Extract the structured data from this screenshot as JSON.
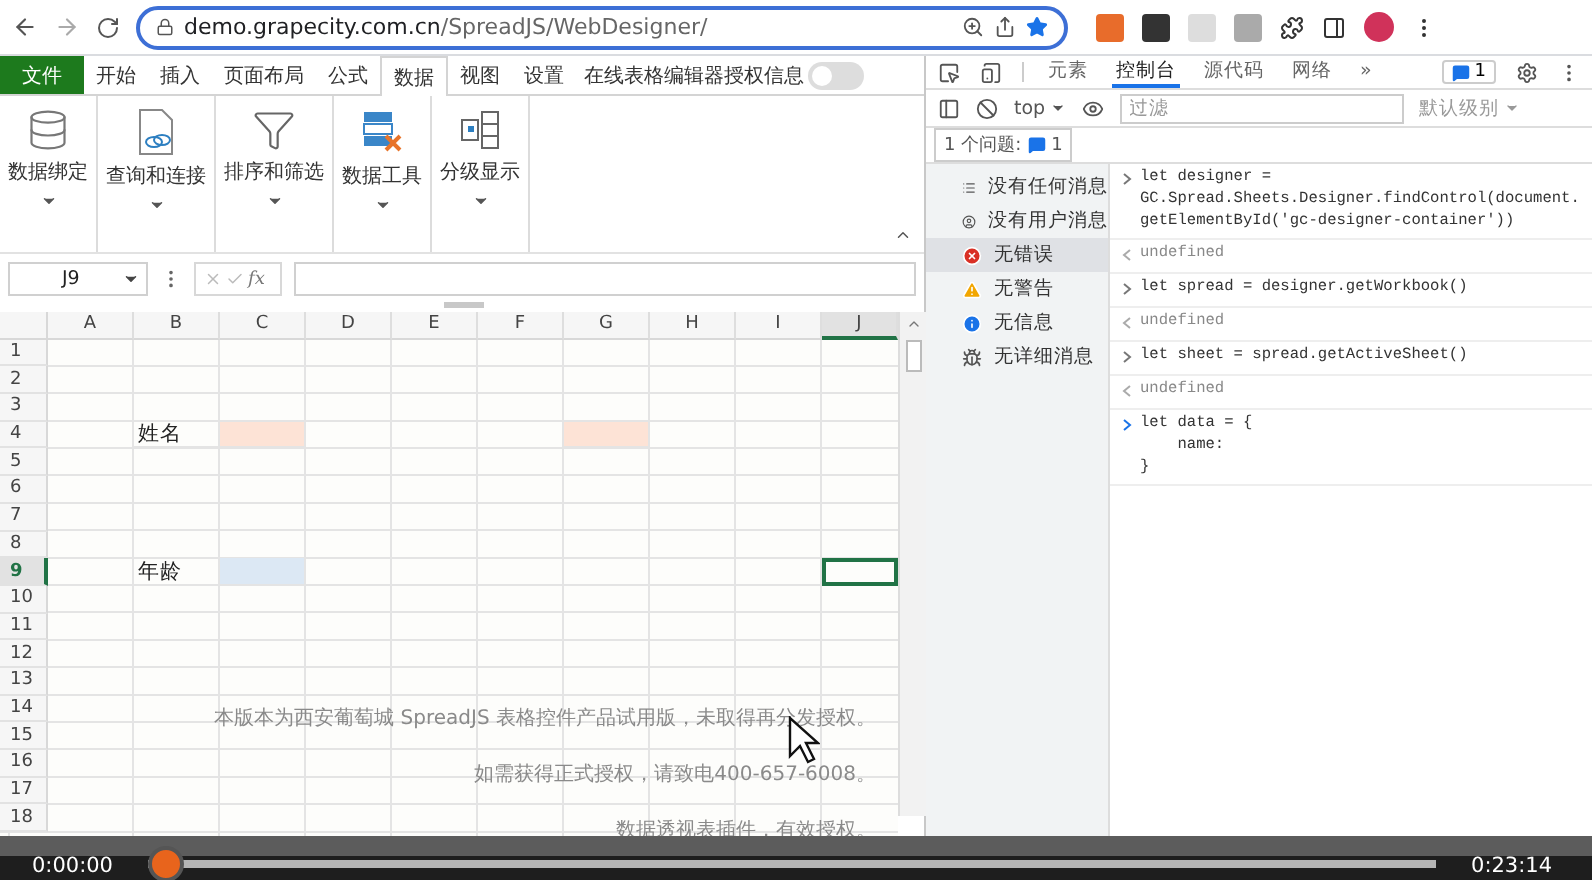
{
  "browser": {
    "url_host": "demo.grapecity.com.cn",
    "url_path": "/SpreadJS/WebDesigner/"
  },
  "ribbon": {
    "tabs": [
      {
        "label": "文件",
        "kind": "file",
        "selected": false
      },
      {
        "label": "开始",
        "kind": "tab",
        "selected": false
      },
      {
        "label": "插入",
        "kind": "tab",
        "selected": false
      },
      {
        "label": "页面布局",
        "kind": "tab",
        "selected": false
      },
      {
        "label": "公式",
        "kind": "tab",
        "selected": false
      },
      {
        "label": "数据",
        "kind": "tab",
        "selected": true
      },
      {
        "label": "视图",
        "kind": "tab",
        "selected": false
      },
      {
        "label": "设置",
        "kind": "tab",
        "selected": false
      }
    ],
    "license_label": "在线表格编辑器授权信息",
    "license_switch": {
      "on": false
    },
    "groups": [
      {
        "label": "数据绑定",
        "kind": "binding"
      },
      {
        "label": "查询和连接",
        "kind": "query"
      },
      {
        "label": "排序和筛选",
        "kind": "sort"
      },
      {
        "label": "数据工具",
        "kind": "tools"
      },
      {
        "label": "分级显示",
        "kind": "outline"
      }
    ]
  },
  "formula_bar": {
    "name_box": "J9",
    "fx": "fx"
  },
  "sheet": {
    "columns": [
      {
        "label": "A",
        "selected": false
      },
      {
        "label": "B",
        "selected": false
      },
      {
        "label": "C",
        "selected": false
      },
      {
        "label": "D",
        "selected": false
      },
      {
        "label": "E",
        "selected": false
      },
      {
        "label": "F",
        "selected": false
      },
      {
        "label": "G",
        "selected": false
      },
      {
        "label": "H",
        "selected": false
      },
      {
        "label": "I",
        "selected": false
      },
      {
        "label": "J",
        "selected": true
      }
    ],
    "rows": [
      {
        "label": "1",
        "selected": false
      },
      {
        "label": "2",
        "selected": false
      },
      {
        "label": "3",
        "selected": false
      },
      {
        "label": "4",
        "selected": false,
        "cells": [
          {
            "kind": "empty"
          },
          {
            "kind": "text",
            "text": "姓名"
          },
          {
            "kind": "fill",
            "color": "#fde3d6"
          },
          {
            "kind": "empty"
          },
          {
            "kind": "empty"
          },
          {
            "kind": "empty"
          },
          {
            "kind": "fill",
            "color": "#fde3d6"
          }
        ]
      },
      {
        "label": "5",
        "selected": false
      },
      {
        "label": "6",
        "selected": false
      },
      {
        "label": "7",
        "selected": false
      },
      {
        "label": "8",
        "selected": false
      },
      {
        "label": "9",
        "selected": true,
        "cells": [
          {
            "kind": "empty"
          },
          {
            "kind": "text",
            "text": "年龄"
          },
          {
            "kind": "fill",
            "color": "#dce8f4"
          }
        ]
      },
      {
        "label": "10",
        "selected": false
      },
      {
        "label": "11",
        "selected": false
      },
      {
        "label": "12",
        "selected": false
      },
      {
        "label": "13",
        "selected": false
      },
      {
        "label": "14",
        "selected": false
      },
      {
        "label": "15",
        "selected": false
      },
      {
        "label": "16",
        "selected": false
      },
      {
        "label": "17",
        "selected": false
      },
      {
        "label": "18",
        "selected": false
      }
    ],
    "watermark_lines": [
      "本版本为西安葡萄城 SpreadJS 表格控件产品试用版，未取得再分发授权。",
      "如需获得正式授权，请致电400-657-6008。",
      "数据透视表插件，有效授权。"
    ]
  },
  "devtools": {
    "tabs": [
      {
        "label": "元素",
        "selected": false
      },
      {
        "label": "控制台",
        "selected": true
      },
      {
        "label": "源代码",
        "selected": false
      },
      {
        "label": "网络",
        "selected": false
      }
    ],
    "more_tabs": "»",
    "issues_badge": "1",
    "context": "top",
    "filter": {
      "placeholder": "过滤"
    },
    "log_level": "默认级别",
    "issues_label": "1 个问题:",
    "issues_count": "1",
    "sidebar": [
      {
        "label": "没有任何消息",
        "kind": "list",
        "selected": false
      },
      {
        "label": "没有用户消息",
        "kind": "user",
        "selected": false
      },
      {
        "label": "无错误",
        "kind": "error",
        "selected": true
      },
      {
        "label": "无警告",
        "kind": "warning",
        "selected": false
      },
      {
        "label": "无信息",
        "kind": "info",
        "selected": false
      },
      {
        "label": "无详细消息",
        "kind": "verbose",
        "selected": false
      }
    ],
    "console": [
      {
        "kind": "input",
        "text": "let designer = GC.Spread.Sheets.Designer.findControl(document.getElementById('gc-designer-container'))"
      },
      {
        "kind": "result",
        "text": "undefined"
      },
      {
        "kind": "input",
        "text": "let spread = designer.getWorkbook()"
      },
      {
        "kind": "result",
        "text": "undefined"
      },
      {
        "kind": "input",
        "text": "let sheet = spread.getActiveSheet()"
      },
      {
        "kind": "result",
        "text": "undefined"
      },
      {
        "kind": "current",
        "text": "let data = {\n    name:\n}"
      }
    ]
  },
  "video": {
    "elapsed": "0:00:00",
    "duration": "0:23:14",
    "level": 0
  }
}
